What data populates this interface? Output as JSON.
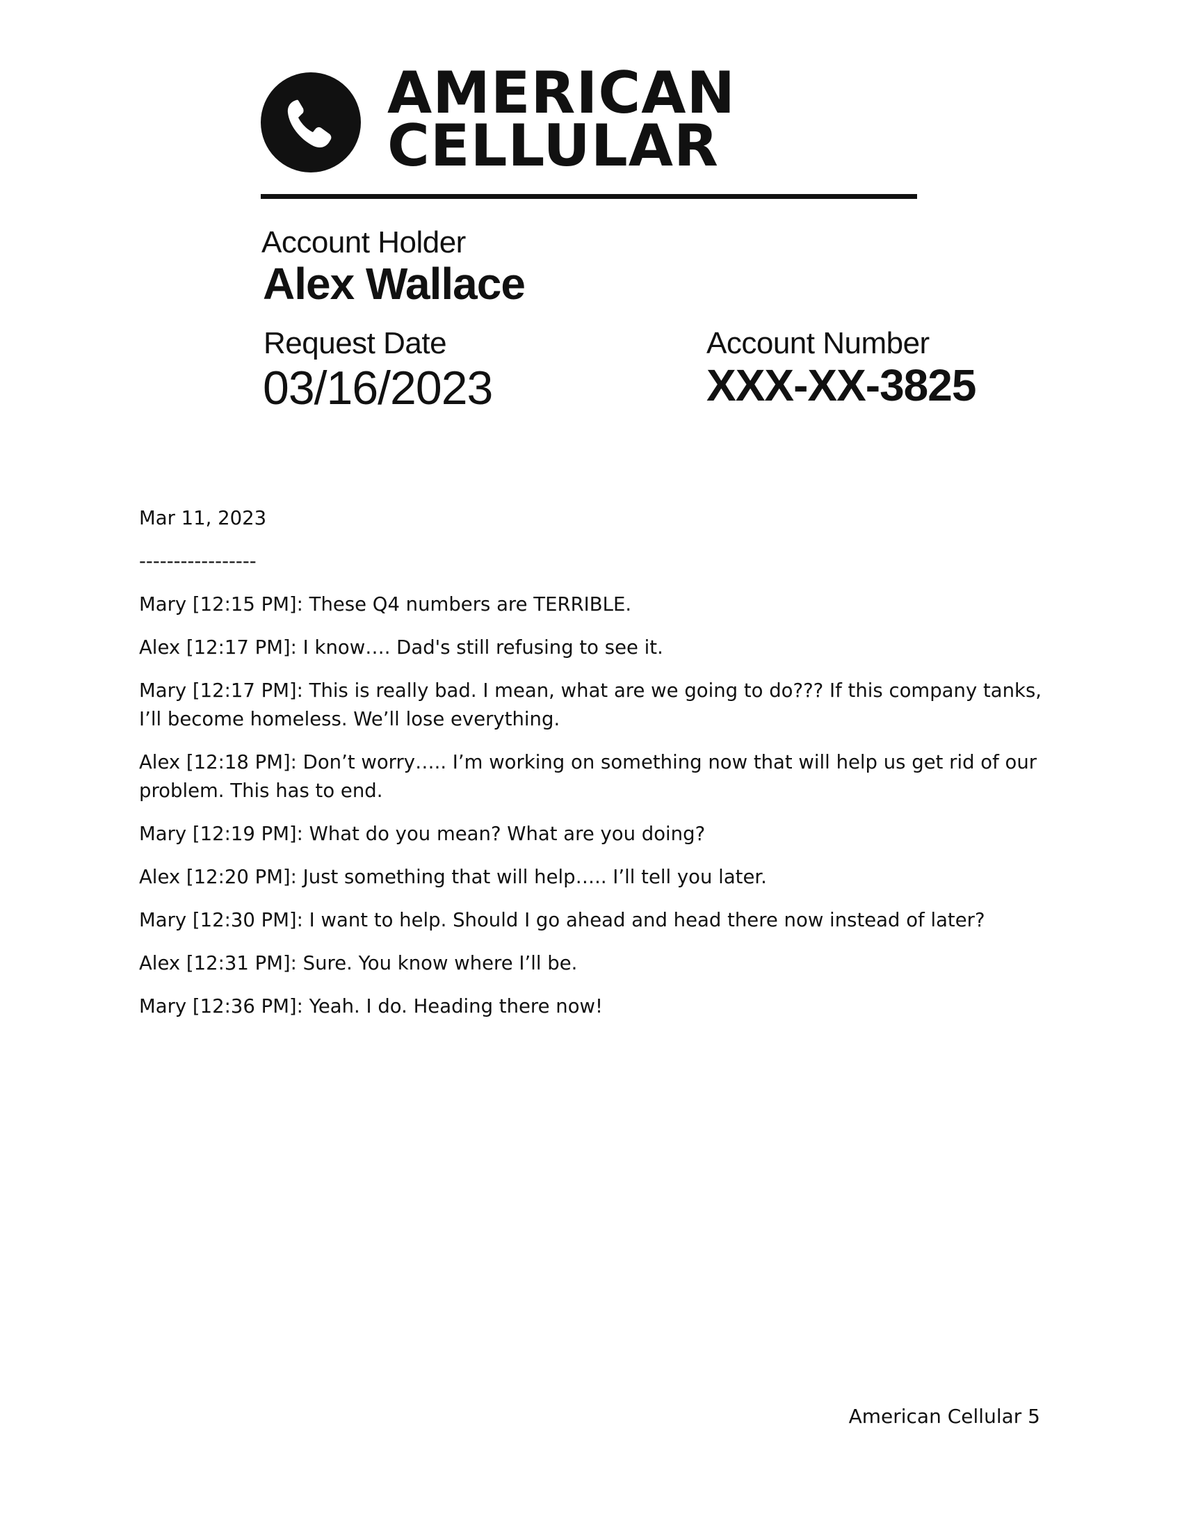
{
  "header": {
    "brand_line1": "AMERICAN",
    "brand_line2": "CELLULAR",
    "logo_icon": "phone-handset-in-circle-icon"
  },
  "account": {
    "holder_label": "Account Holder",
    "holder_name": "Alex Wallace",
    "request_date_label": "Request Date",
    "request_date": "03/16/2023",
    "account_number_label": "Account Number",
    "account_number": "XXX-XX-3825"
  },
  "transcript": {
    "date": "Mar 11, 2023",
    "separator": "-----------------",
    "messages": [
      "Mary [12:15 PM]: These Q4 numbers are TERRIBLE.",
      "Alex [12:17 PM]: I know…. Dad's still refusing to see it.",
      "Mary [12:17 PM]: This is really bad. I mean, what are we going to do??? If this company tanks, I’ll become homeless. We’ll lose everything.",
      "Alex [12:18 PM]: Don’t worry….. I’m working on something now that will help us get rid of our problem. This has to end.",
      "Mary [12:19 PM]: What do you mean? What are you doing?",
      "Alex [12:20 PM]: Just something that will help….. I’ll tell you later.",
      "Mary [12:30 PM]: I want to help. Should I go ahead and head there now instead of later?",
      "Alex [12:31 PM]: Sure. You know where I’ll be.",
      "Mary [12:36 PM]: Yeah. I do. Heading there now!"
    ]
  },
  "footer": {
    "text": "American Cellular 5"
  },
  "colors": {
    "ink": "#111111",
    "paper": "#ffffff"
  }
}
